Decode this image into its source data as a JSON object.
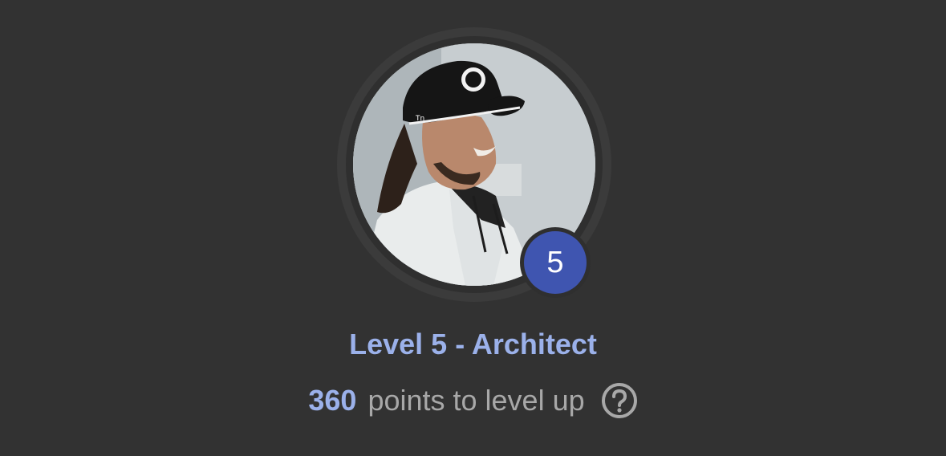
{
  "profile": {
    "level_badge": "5",
    "level_title": "Level 5 - Architect",
    "points_value": "360",
    "points_text": "points to level up",
    "help_icon": "question-circle-icon",
    "avatar_alt": "profile-photo"
  },
  "colors": {
    "background": "#323232",
    "accent": "#9bb1ea",
    "badge": "#3f55b0",
    "muted_text": "#a8a8a8"
  }
}
